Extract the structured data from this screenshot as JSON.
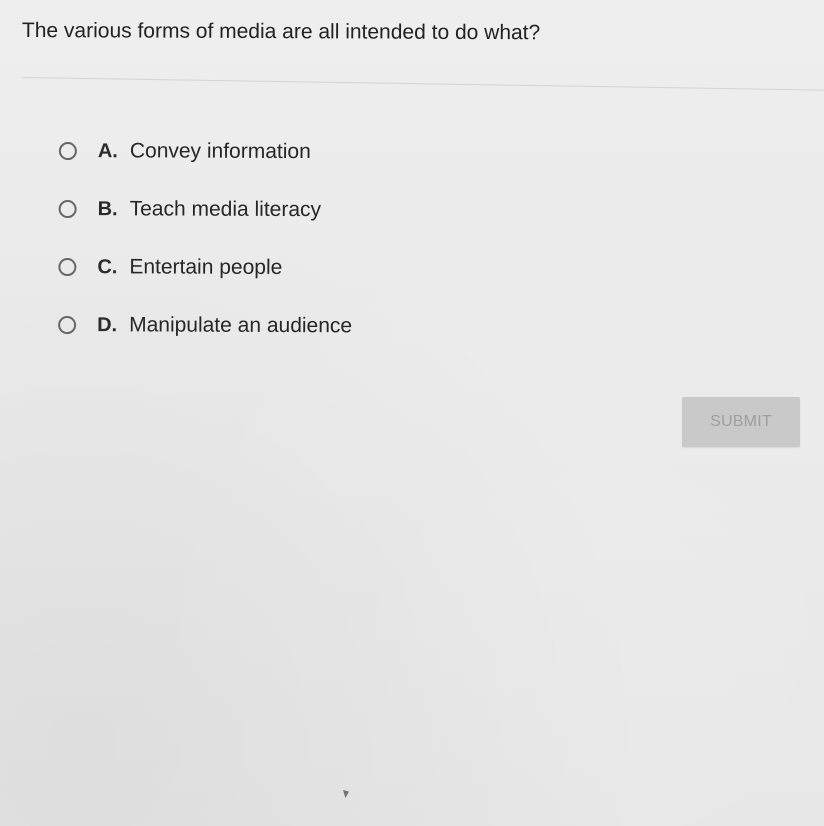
{
  "question": {
    "text": "The various forms of media are all intended to do what?"
  },
  "options": [
    {
      "letter": "A.",
      "text": "Convey information",
      "icon": "radio-unselected-icon"
    },
    {
      "letter": "B.",
      "text": "Teach media literacy",
      "icon": "radio-unselected-icon"
    },
    {
      "letter": "C.",
      "text": "Entertain people",
      "icon": "radio-unselected-icon"
    },
    {
      "letter": "D.",
      "text": "Manipulate an audience",
      "icon": "radio-unselected-icon"
    }
  ],
  "submit": {
    "label": "SUBMIT",
    "state": "disabled"
  },
  "colors": {
    "background": "#ebebeb",
    "text": "#262626",
    "submit_bg": "#c9c9c9",
    "submit_text": "#9e9e9e"
  }
}
